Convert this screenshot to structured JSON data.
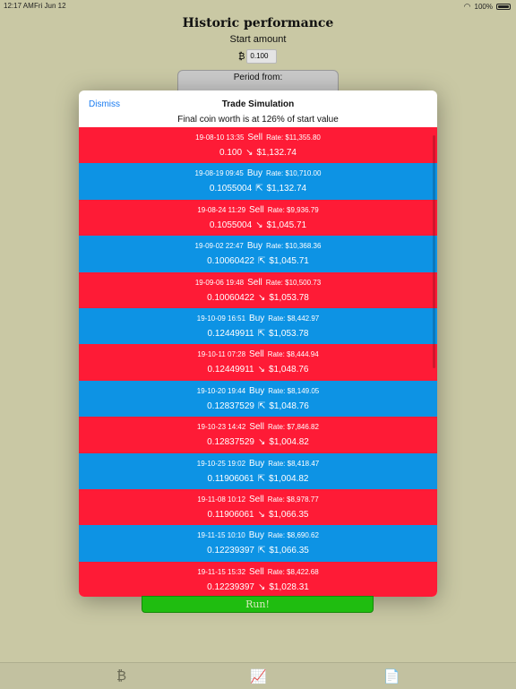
{
  "status": {
    "time": "12:17 AM",
    "date": "Fri Jun 12",
    "battery": "100%"
  },
  "background": {
    "title": "Historic performance",
    "start_label": "Start amount",
    "currency_symbol": "₿",
    "start_value": "0.100",
    "period_label": "Period from:",
    "run_label": "Run!"
  },
  "modal": {
    "dismiss_label": "Dismiss",
    "title": "Trade Simulation",
    "subtitle": "Final coin worth is at 126% of start value",
    "rows": [
      {
        "type": "sell",
        "date": "19-08-10 13:35",
        "action": "Sell",
        "rate": "Rate: $11,355.80",
        "coins": "0.100",
        "arrow": "↘",
        "value": "$1,132.74"
      },
      {
        "type": "buy",
        "date": "19-08-19 09:45",
        "action": "Buy",
        "rate": "Rate: $10,710.00",
        "coins": "0.1055004",
        "arrow": "⇱",
        "value": "$1,132.74"
      },
      {
        "type": "sell",
        "date": "19-08-24 11:29",
        "action": "Sell",
        "rate": "Rate: $9,936.79",
        "coins": "0.1055004",
        "arrow": "↘",
        "value": "$1,045.71"
      },
      {
        "type": "buy",
        "date": "19-09-02 22:47",
        "action": "Buy",
        "rate": "Rate: $10,368.36",
        "coins": "0.10060422",
        "arrow": "⇱",
        "value": "$1,045.71"
      },
      {
        "type": "sell",
        "date": "19-09-06 19:48",
        "action": "Sell",
        "rate": "Rate: $10,500.73",
        "coins": "0.10060422",
        "arrow": "↘",
        "value": "$1,053.78"
      },
      {
        "type": "buy",
        "date": "19-10-09 16:51",
        "action": "Buy",
        "rate": "Rate: $8,442.97",
        "coins": "0.12449911",
        "arrow": "⇱",
        "value": "$1,053.78"
      },
      {
        "type": "sell",
        "date": "19-10-11 07:28",
        "action": "Sell",
        "rate": "Rate: $8,444.94",
        "coins": "0.12449911",
        "arrow": "↘",
        "value": "$1,048.76"
      },
      {
        "type": "buy",
        "date": "19-10-20 19:44",
        "action": "Buy",
        "rate": "Rate: $8,149.05",
        "coins": "0.12837529",
        "arrow": "⇱",
        "value": "$1,048.76"
      },
      {
        "type": "sell",
        "date": "19-10-23 14:42",
        "action": "Sell",
        "rate": "Rate: $7,846.82",
        "coins": "0.12837529",
        "arrow": "↘",
        "value": "$1,004.82"
      },
      {
        "type": "buy",
        "date": "19-10-25 19:02",
        "action": "Buy",
        "rate": "Rate: $8,418.47",
        "coins": "0.11906061",
        "arrow": "⇱",
        "value": "$1,004.82"
      },
      {
        "type": "sell",
        "date": "19-11-08 10:12",
        "action": "Sell",
        "rate": "Rate: $8,978.77",
        "coins": "0.11906061",
        "arrow": "↘",
        "value": "$1,066.35"
      },
      {
        "type": "buy",
        "date": "19-11-15 10:10",
        "action": "Buy",
        "rate": "Rate: $8,690.62",
        "coins": "0.12239397",
        "arrow": "⇱",
        "value": "$1,066.35"
      },
      {
        "type": "sell",
        "date": "19-11-15 15:32",
        "action": "Sell",
        "rate": "Rate: $8,422.68",
        "coins": "0.12239397",
        "arrow": "↘",
        "value": "$1,028.31"
      }
    ]
  },
  "tabbar": {
    "tabs": [
      {
        "name": "bitcoin-tab",
        "icon": "₿"
      },
      {
        "name": "chart-tab",
        "icon": "📈"
      },
      {
        "name": "document-tab",
        "icon": "📄"
      }
    ]
  },
  "colors": {
    "sell": "#fe1b36",
    "buy": "#0d93e4",
    "run": "#1fbd10",
    "background": "#c9c8a4",
    "link": "#1a7cf0"
  }
}
